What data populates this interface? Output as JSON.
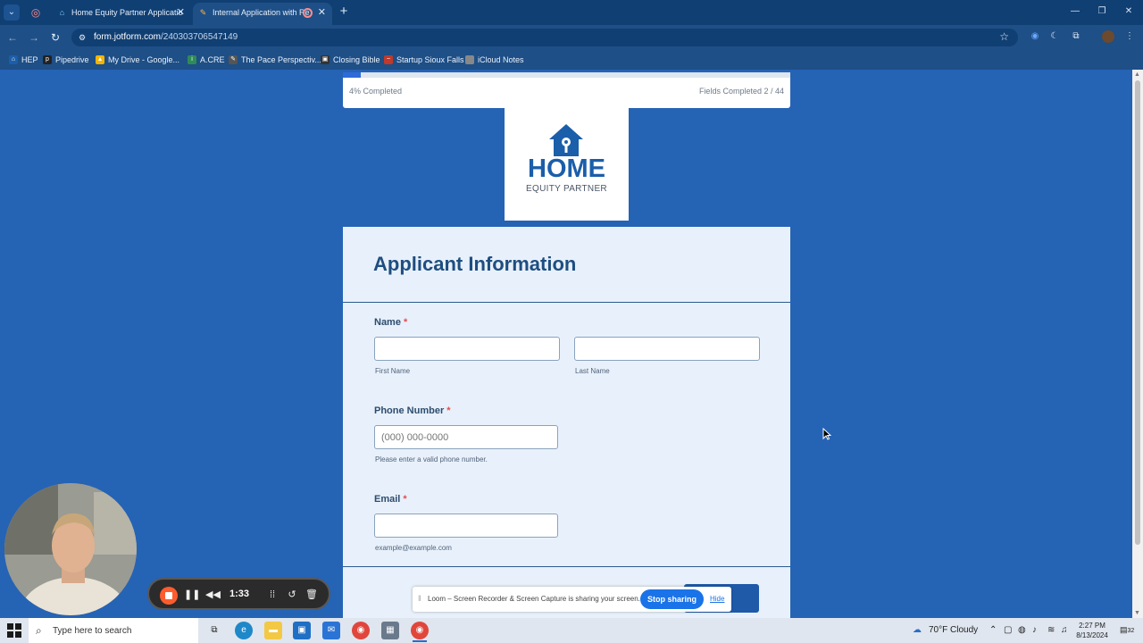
{
  "browser": {
    "tabs": [
      {
        "title": "Home Equity Partner Applicatio",
        "active": false
      },
      {
        "title": "Internal Application with Re",
        "active": true
      }
    ],
    "url_host": "form.jotform.com",
    "url_path": "/240303706547149",
    "bookmarks": [
      {
        "label": "HEP",
        "color": "#1b5eaa"
      },
      {
        "label": "Pipedrive",
        "color": "#222222"
      },
      {
        "label": "My Drive - Google...",
        "color": "#f4b400"
      },
      {
        "label": "A.CRE",
        "color": "#2e8b57"
      },
      {
        "label": "The Pace Perspectiv...",
        "color": "#555555"
      },
      {
        "label": "Closing Bible",
        "color": "#333333"
      },
      {
        "label": "Startup Sioux Falls",
        "color": "#c0392b"
      },
      {
        "label": "iCloud Notes",
        "color": "#888888"
      }
    ]
  },
  "form": {
    "progress_percent": 4,
    "progress_text": "4%  Completed",
    "fields_completed_text": "Fields Completed  2 / 44",
    "logo_title": "HOME",
    "logo_subtitle": "EQUITY PARTNER",
    "section_title": "Applicant Information",
    "name_label": "Name",
    "first_name_sublabel": "First Name",
    "last_name_sublabel": "Last Name",
    "phone_label": "Phone Number",
    "phone_placeholder": "(000) 000-0000",
    "phone_hint": "Please enter a valid phone number.",
    "email_label": "Email",
    "email_hint": "example@example.com",
    "required_mark": "*"
  },
  "loom": {
    "timer": "1:33",
    "share_text": "Loom – Screen Recorder & Screen Capture is sharing your screen.",
    "stop_label": "Stop sharing",
    "hide_label": "Hide"
  },
  "taskbar": {
    "search_placeholder": "Type here to search",
    "weather": "70°F  Cloudy",
    "time": "2:27 PM",
    "date": "8/13/2024",
    "notification_count": "32"
  },
  "colors": {
    "page_bg": "#2563b5",
    "accent": "#1b5eaa",
    "required": "#e34d4d"
  }
}
